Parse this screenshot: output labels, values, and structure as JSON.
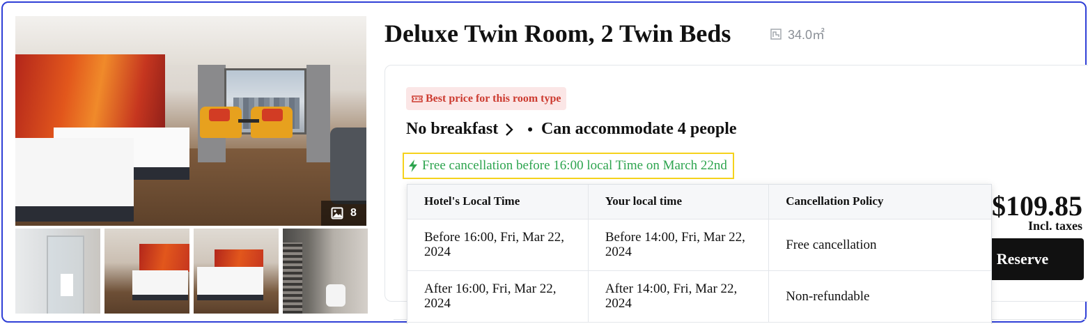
{
  "gallery": {
    "photo_count": "8",
    "photo_count_icon": "image-icon",
    "thumbnails": [
      "bathroom",
      "room-overview",
      "twin-beds",
      "bathroom-toilet"
    ]
  },
  "room": {
    "title": "Deluxe Twin Room, 2 Twin Beds",
    "size_icon": "floor-area-icon",
    "size": "34.0㎡"
  },
  "offer": {
    "badge_icon": "ticket-icon",
    "badge": "Best price for this room type",
    "meal": "No breakfast",
    "separator": "•",
    "capacity": "Can accommodate 4 people",
    "cancel_icon": "lightning-icon",
    "free_cancellation": "Free cancellation before 16:00 local Time on March 22nd",
    "price": "$109.85",
    "tax_note": "Incl. taxes",
    "reserve_label": "Reserve"
  },
  "policy_table": {
    "headers": [
      "Hotel's Local Time",
      "Your local time",
      "Cancellation Policy"
    ],
    "rows": [
      [
        "Before 16:00, Fri, Mar 22, 2024",
        "Before 14:00, Fri, Mar 22, 2024",
        "Free cancellation"
      ],
      [
        "After 16:00, Fri, Mar 22, 2024",
        "After 14:00, Fri, Mar 22, 2024",
        "Non-refundable"
      ]
    ]
  },
  "colors": {
    "frame_border": "#2f3fd6",
    "badge_bg": "#fbe6e6",
    "badge_text": "#cc3a2f",
    "free_cancel_text": "#2da44e",
    "highlight_border": "#f5d21c",
    "reserve_bg": "#111111"
  }
}
